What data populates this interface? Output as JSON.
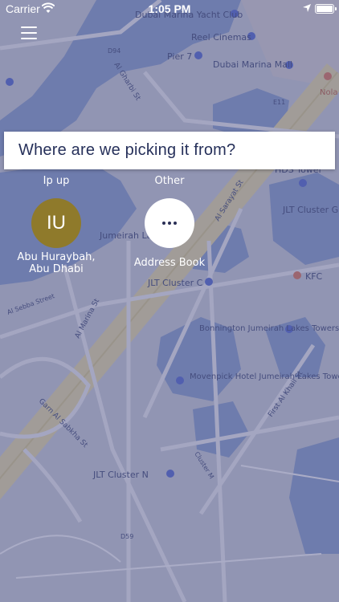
{
  "status_bar": {
    "carrier": "Carrier",
    "time": "1:05 PM"
  },
  "map": {
    "labels": [
      "Dubai Marina Yacht Club",
      "Reel Cinemas",
      "Pier 7",
      "Dubai Marina Mall",
      "Al Gharbi St",
      "Jumeirah La",
      "JLT Cluster C",
      "JLT Cluster G",
      "HDS Tower",
      "KFC",
      "Bonnington Jumeirah Lakes Towers",
      "Movenpick Hotel Jumeirah Lakes Towers",
      "Al Sarayat St",
      "Al Marina St",
      "Al Sebba Street",
      "Garn Al Sabkha St",
      "First Al Khail St",
      "JLT Cluster N",
      "Cluster M",
      "Nola Soci",
      "D94",
      "E11",
      "D59"
    ]
  },
  "search": {
    "placeholder": "Where are we picking it from?"
  },
  "places": {
    "pickup": {
      "heading": "Ip up",
      "initials": "IU",
      "address": "Abu Huraybah,\nAbu Dhabi"
    },
    "other": {
      "heading": "Other",
      "caption": "Address Book"
    }
  }
}
